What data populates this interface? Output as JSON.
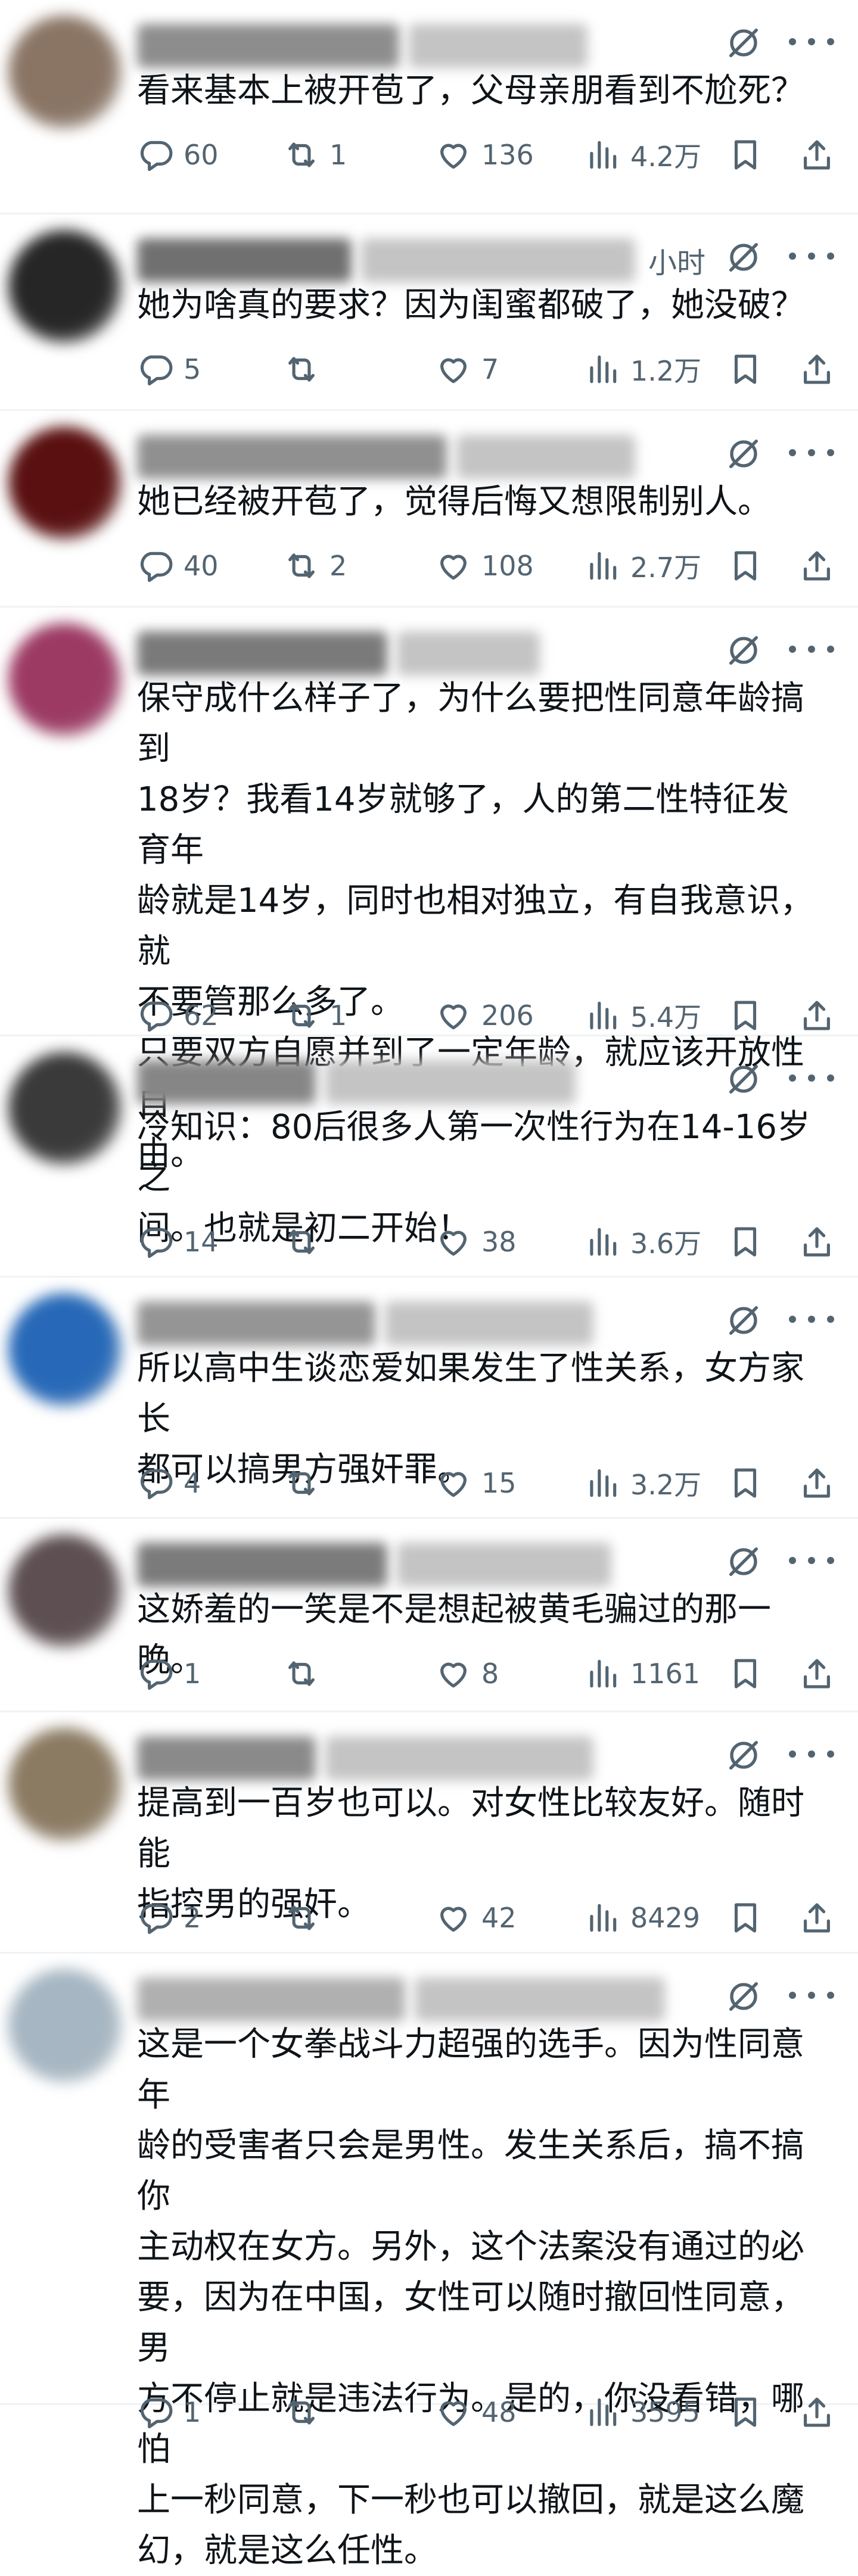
{
  "colors": {
    "text": "#0f1419",
    "secondary": "#536471",
    "divider": "#eff3f4"
  },
  "icons": {
    "reply": "speech-bubble-icon",
    "retweet": "retweet-arrows-icon",
    "like": "heart-icon",
    "views": "bar-chart-icon",
    "bookmark": "bookmark-icon",
    "share": "share-upload-icon",
    "grok": "grok-slash-icon",
    "more": "more-dots-icon"
  },
  "replies": [
    {
      "time": "",
      "text": "看来基本上被开苞了，父母亲朋看到不尬死？",
      "reply_count": "60",
      "retweet_count": "1",
      "like_count": "136",
      "view_count": "4.2万"
    },
    {
      "time": "小时",
      "text": "她为啥真的要求？因为闺蜜都破了，她没破？",
      "reply_count": "5",
      "retweet_count": "",
      "like_count": "7",
      "view_count": "1.2万"
    },
    {
      "time": "",
      "text": "她已经被开苞了，觉得后悔又想限制别人。",
      "reply_count": "40",
      "retweet_count": "2",
      "like_count": "108",
      "view_count": "2.7万"
    },
    {
      "time": "",
      "text": "保守成什么样子了，为什么要把性同意年龄搞到\n18岁？我看14岁就够了，人的第二性特征发育年\n龄就是14岁，同时也相对独立，有自我意识，就\n不要管那么多了。\n只要双方自愿并到了一定年龄，就应该开放性自\n由。",
      "reply_count": "62",
      "retweet_count": "1",
      "like_count": "206",
      "view_count": "5.4万"
    },
    {
      "time": "",
      "text": "冷知识：80后很多人第一次性行为在14-16岁之\n间。也就是初二开始！",
      "reply_count": "14",
      "retweet_count": "",
      "like_count": "38",
      "view_count": "3.6万"
    },
    {
      "time": "",
      "text": "所以高中生谈恋爱如果发生了性关系，女方家长\n都可以搞男方强奸罪。",
      "reply_count": "4",
      "retweet_count": "",
      "like_count": "15",
      "view_count": "3.2万"
    },
    {
      "time": "",
      "text": "这娇羞的一笑是不是想起被黄毛骗过的那一晚。",
      "reply_count": "1",
      "retweet_count": "",
      "like_count": "8",
      "view_count": "1161"
    },
    {
      "time": "",
      "text": "提高到一百岁也可以。对女性比较友好。随时能\n指控男的强奸。",
      "reply_count": "2",
      "retweet_count": "",
      "like_count": "42",
      "view_count": "8429"
    },
    {
      "time": "",
      "text": "这是一个女拳战斗力超强的选手。因为性同意年\n龄的受害者只会是男性。发生关系后，搞不搞你\n主动权在女方。另外，这个法案没有通过的必\n要，因为在中国，女性可以随时撤回性同意，男\n方不停止就是违法行为。是的，你没看错，哪怕\n上一秒同意，下一秒也可以撤回，就是这么魔\n幻，就是这么任性。",
      "reply_count": "1",
      "retweet_count": "",
      "like_count": "48",
      "view_count": "3595"
    }
  ]
}
